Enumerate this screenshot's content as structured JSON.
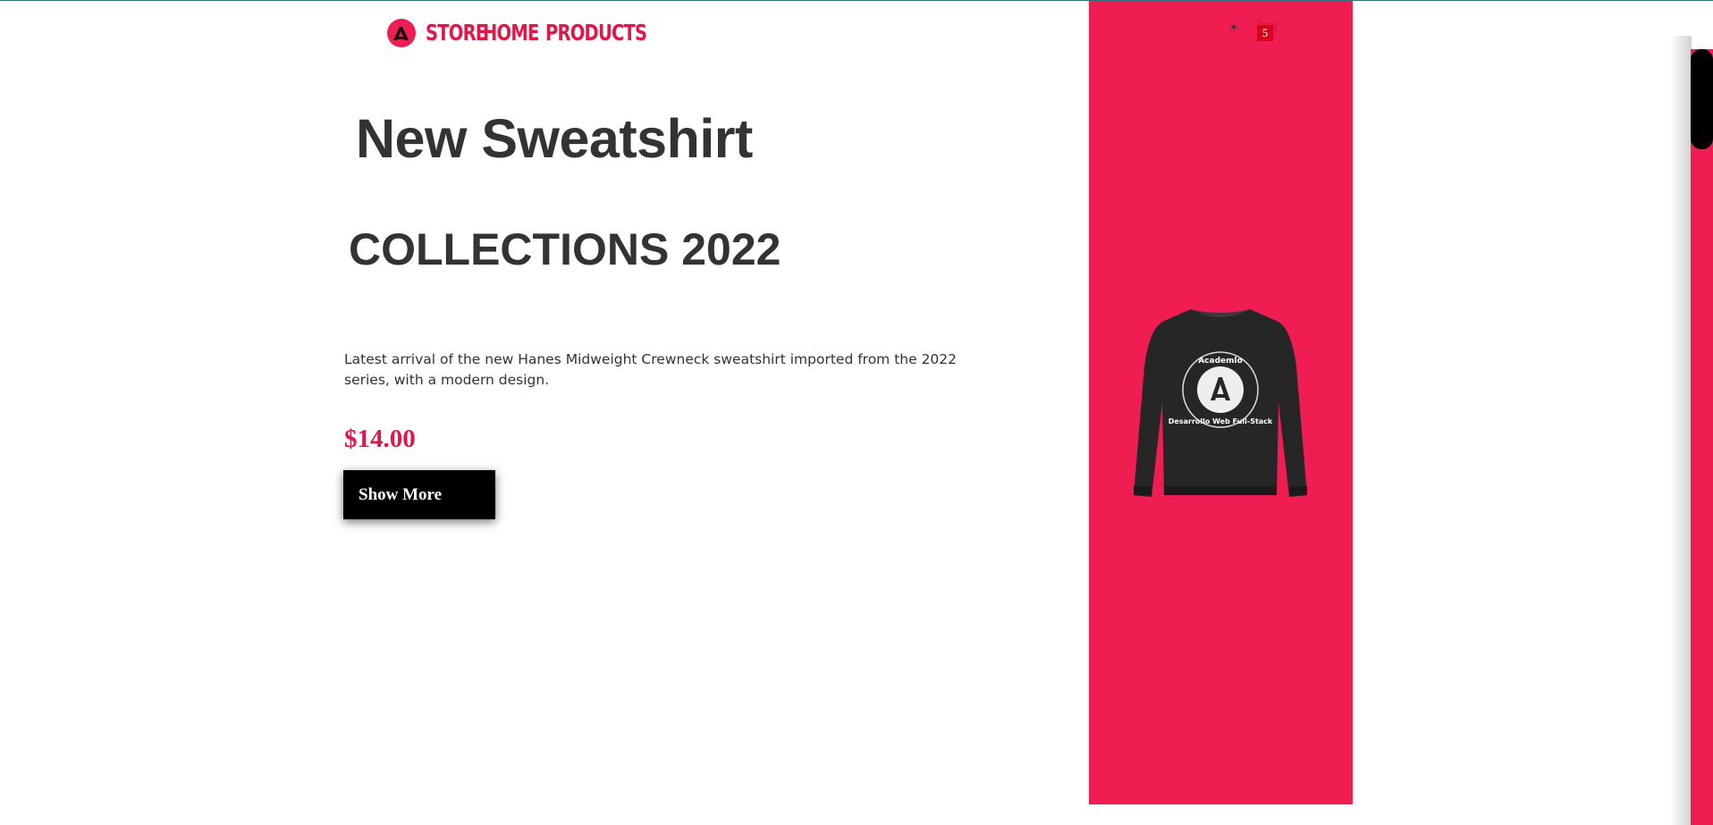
{
  "nav": {
    "brand": "STORE",
    "links": [
      {
        "label": "HOME"
      },
      {
        "label": "PRODUCTS"
      }
    ],
    "theme_icon": "sun-icon",
    "cart_icon": "cart-icon",
    "cart_count": "5"
  },
  "hero": {
    "title": "New Sweatshirt",
    "subtitle": "COLLECTIONS 2022",
    "description": "Latest arrival of the new Hanes Midweight Crewneck sweatshirt imported from the 2022 series, with a modern design.",
    "price": "$14.00",
    "button_label": "Show More",
    "product_image": {
      "badge_top": "Academlo",
      "badge_bottom": "Desarrollo Web Full-Stack"
    }
  },
  "colors": {
    "accent": "#ef1d51",
    "text": "#333333",
    "button": "#000000"
  }
}
